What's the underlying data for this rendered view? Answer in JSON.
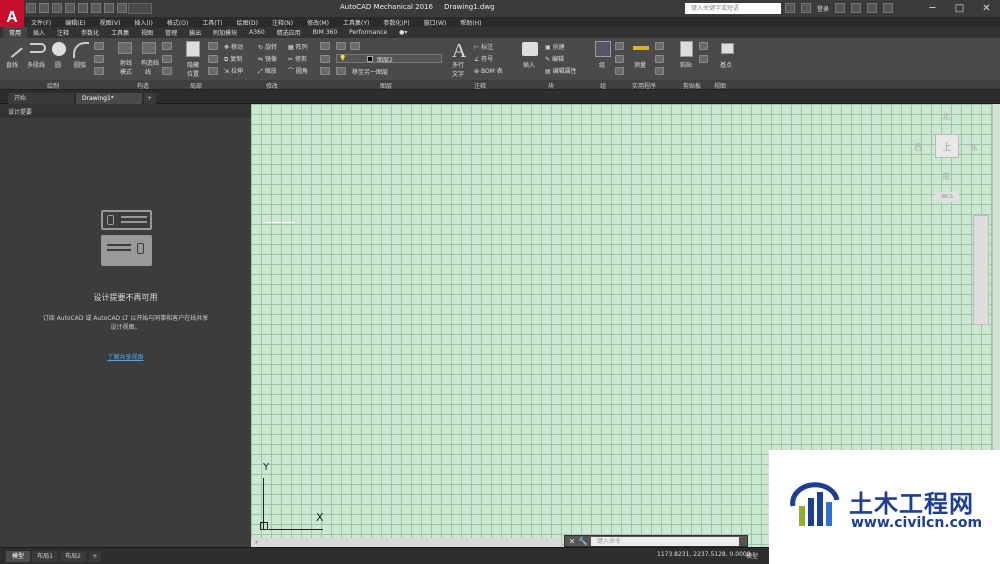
{
  "window": {
    "title": "AutoCAD Mechanical 2016",
    "document": "Drawing1.dwg",
    "search_placeholder": "键入关键字或短语",
    "login_label": "登录",
    "minimize_glyph": "─",
    "maximize_glyph": "□",
    "close_glyph": "✕"
  },
  "app_logo": "A",
  "menus": [
    "文件(F)",
    "编辑(E)",
    "视图(V)",
    "插入(I)",
    "格式(O)",
    "工具(T)",
    "绘图(D)",
    "注释(N)",
    "修改(M)",
    "工具集(Y)",
    "参数化(P)",
    "窗口(W)",
    "帮助(H)"
  ],
  "ribbon_tabs": [
    "常用",
    "插入",
    "注释",
    "参数化",
    "工具集",
    "视图",
    "管理",
    "输出",
    "附加模块",
    "A360",
    "精选应用",
    "BIM 360",
    "Performance"
  ],
  "ribbon": {
    "draw_tools": [
      "直线",
      "多段线",
      "圆",
      "圆弧"
    ],
    "construction_tools": [
      "射线",
      "构造线"
    ],
    "construction_sub": [
      "模式",
      "线"
    ],
    "detail": "隐藏",
    "detail_sub": "位置",
    "modify_row1": [
      "移动",
      "旋转",
      "阵列"
    ],
    "modify_row2": [
      "复制",
      "镜像",
      "修剪"
    ],
    "modify_row3": [
      "拉伸",
      "缩放",
      "圆角"
    ],
    "layer_name": "图层2",
    "layer_tool": "移至另一图层",
    "annotation_big": "多行",
    "annotation_big_sub": "文字",
    "annotation_tools": [
      "标注",
      "符号",
      "BOM 表"
    ],
    "block_big": "插入",
    "block_tools": [
      "创建",
      "编辑",
      "编辑属性"
    ],
    "group_big": "组",
    "measure_big": "测量",
    "paste_big": "粘贴",
    "base_big": "基点"
  },
  "panel_labels": [
    "绘制",
    "构造",
    "局部",
    "修改",
    "图层",
    "注释",
    "块",
    "组",
    "实用程序",
    "剪贴板",
    "视图"
  ],
  "doc_tabs": [
    "开始",
    "Drawing1*"
  ],
  "doc_tab_add": "+",
  "left_panel": {
    "header": "设计提要",
    "title": "设计提要不再可用",
    "body": "订阅 AutoCAD 或 AutoCAD LT 以开始与同事和客户在线共享设计视图。",
    "link": "了解共享视图"
  },
  "viewcube": {
    "north": "北",
    "south": "南",
    "east": "东",
    "west": "西",
    "face": "上",
    "wcs": "WCS"
  },
  "ucs": {
    "x": "X",
    "y": "Y"
  },
  "command_line": {
    "placeholder": "键入命令",
    "close": "✕",
    "tool": "🔧"
  },
  "layout_tabs": [
    "模型",
    "布局1",
    "布局2"
  ],
  "layout_add": "+",
  "status": {
    "coordinates": "1173.8231, 2237.5128, 0.0000",
    "mode": "模型"
  },
  "watermark": {
    "name": "土木工程网",
    "url": "www.civilcn.com"
  },
  "colors": {
    "canvas": "#cde8d2",
    "grid": "#9fc5a7",
    "accent": "#c8102e",
    "link": "#4aa8e6",
    "watermark": "#1c3f93"
  }
}
